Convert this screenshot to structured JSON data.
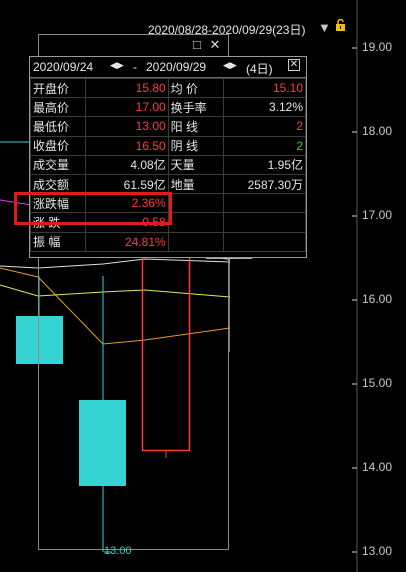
{
  "axis": {
    "labels": [
      "19.00",
      "18.00",
      "17.00",
      "16.00",
      "15.00",
      "14.00",
      "13.00"
    ]
  },
  "range_bar": {
    "text": "2020/08/28-2020/09/29(23日)"
  },
  "panel": {
    "date_start": "2020/09/24",
    "date_end": "2020/09/29",
    "nav_arrows": "◀▶",
    "dash": "-",
    "count": "(4日)",
    "close": "✕",
    "rows": [
      {
        "l": "开盘价",
        "v": "15.80",
        "vc": "red",
        "l2": "均  价",
        "v2": "15.10",
        "v2c": "red"
      },
      {
        "l": "最高价",
        "v": "17.00",
        "vc": "red",
        "l2": "换手率",
        "v2": "3.12%",
        "v2c": "wht"
      },
      {
        "l": "最低价",
        "v": "13.00",
        "vc": "red",
        "l2": "阳  线",
        "v2": "2",
        "v2c": "red"
      },
      {
        "l": "收盘价",
        "v": "16.50",
        "vc": "red",
        "l2": "阴  线",
        "v2": "2",
        "v2c": "green"
      },
      {
        "l": "成交量",
        "v": "4.08亿",
        "vc": "wht",
        "l2": "天量",
        "v2": "1.95亿",
        "v2c": "wht"
      },
      {
        "l": "成交额",
        "v": "61.59亿",
        "vc": "wht",
        "l2": "地量",
        "v2": "2587.30万",
        "v2c": "wht"
      },
      {
        "l": "涨跌幅",
        "v": "2.36%",
        "vc": "red",
        "l2": "",
        "v2": "",
        "v2c": "wht"
      },
      {
        "l": "涨  跌",
        "v": "0.58",
        "vc": "red",
        "l2": "",
        "v2": "",
        "v2c": "wht"
      },
      {
        "l": "振  幅",
        "v": "24.81%",
        "vc": "red",
        "l2": "",
        "v2": "",
        "v2c": "wht"
      }
    ]
  },
  "low_marker": {
    "text": "13.00"
  },
  "colors": {
    "up": "#ff3b3b",
    "down": "#36d3d3",
    "accent": "#e01b1b"
  }
}
